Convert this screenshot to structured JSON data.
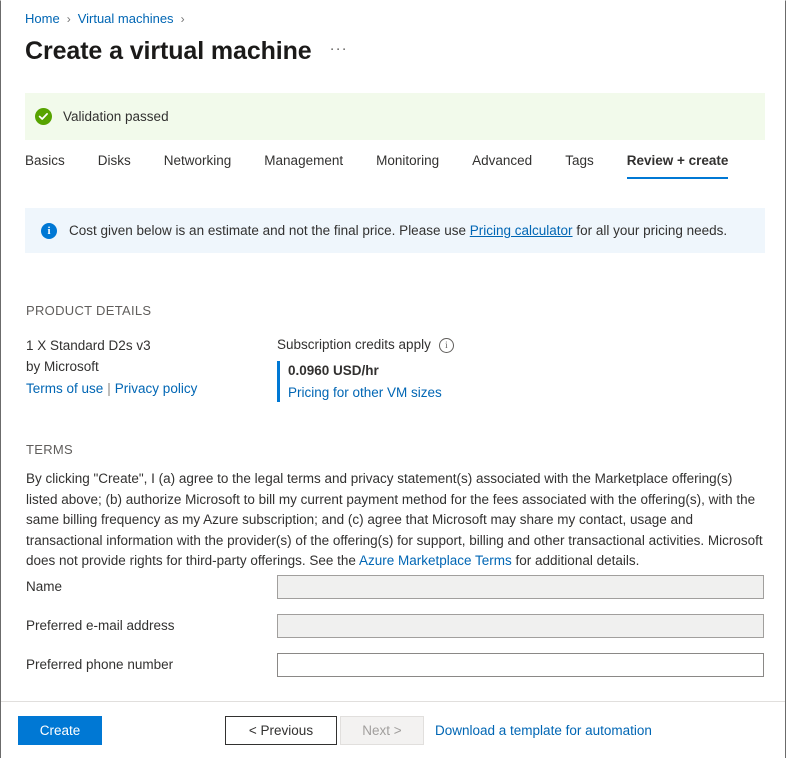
{
  "breadcrumb": {
    "items": [
      {
        "label": "Home"
      },
      {
        "label": "Virtual machines"
      }
    ],
    "separator": "›"
  },
  "header": {
    "title": "Create a virtual machine",
    "more_menu": "···"
  },
  "validation": {
    "message": "Validation passed",
    "icon": "check-circle-icon",
    "background": "#f2faeb",
    "accent": "#57a300"
  },
  "tabs": [
    {
      "label": "Basics",
      "active": false
    },
    {
      "label": "Disks",
      "active": false
    },
    {
      "label": "Networking",
      "active": false
    },
    {
      "label": "Management",
      "active": false
    },
    {
      "label": "Monitoring",
      "active": false
    },
    {
      "label": "Advanced",
      "active": false
    },
    {
      "label": "Tags",
      "active": false
    },
    {
      "label": "Review + create",
      "active": true
    }
  ],
  "info_banner": {
    "icon": "info-circle-icon",
    "text_before": "Cost given below is an estimate and not the final price. Please use",
    "link": "Pricing calculator",
    "text_after": "for all your pricing needs.",
    "background": "#eff6fc",
    "accent": "#0078d4"
  },
  "product_details": {
    "heading": "PRODUCT DETAILS",
    "sku": "1 X Standard D2s v3",
    "publisher": "by Microsoft",
    "terms_of_use_link": "Terms of use",
    "link_divider": "|",
    "privacy_policy_link": "Privacy policy",
    "credits_label": "Subscription credits apply",
    "credits_info_icon": "info-outline-icon",
    "price": "0.0960 USD/hr",
    "other_sizes_link": "Pricing for other VM sizes",
    "accent": "#0078d4"
  },
  "terms": {
    "heading": "TERMS",
    "paragraph_before": "By clicking \"Create\", I (a) agree to the legal terms and privacy statement(s) associated with the Marketplace offering(s) listed above; (b) authorize Microsoft to bill my current payment method for the fees associated with the offering(s), with the same billing frequency as my Azure subscription; and (c) agree that Microsoft may share my contact, usage and transactional information with the provider(s) of the offering(s) for support, billing and other transactional activities. Microsoft does not provide rights for third-party offerings. See the",
    "link": "Azure Marketplace Terms",
    "paragraph_after": "for additional details."
  },
  "form": {
    "fields": [
      {
        "label": "Name",
        "value": "",
        "placeholder": "",
        "editable": false
      },
      {
        "label": "Preferred e-mail address",
        "value": "",
        "placeholder": "",
        "editable": false
      },
      {
        "label": "Preferred phone number",
        "value": "",
        "placeholder": "",
        "editable": true
      }
    ]
  },
  "footer": {
    "create_label": "Create",
    "previous_label": "< Previous",
    "next_label": "Next >",
    "next_disabled": true,
    "download_link": "Download a template for automation",
    "primary_color": "#0078d4"
  }
}
